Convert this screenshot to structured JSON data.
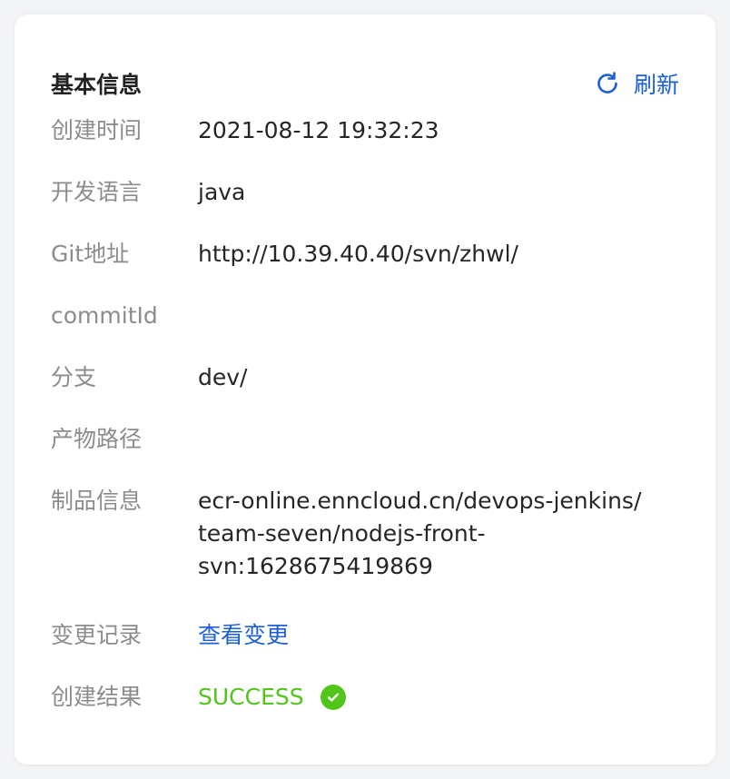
{
  "header": {
    "title": "基本信息",
    "refresh_label": "刷新"
  },
  "fields": [
    {
      "label": "创建时间",
      "value": "2021-08-12  19:32:23"
    },
    {
      "label": "开发语言",
      "value": "java"
    },
    {
      "label": "Git地址",
      "value": "http://10.39.40.40/svn/zhwl/"
    },
    {
      "label": "commitId",
      "value": ""
    },
    {
      "label": "分支",
      "value": "dev/"
    },
    {
      "label": "产物路径",
      "value": ""
    },
    {
      "label": "制品信息",
      "value_lines": [
        "ecr-online.enncloud.cn/devops-jenkins/",
        "team-seven/nodejs-front-",
        "svn:1628675419869"
      ]
    },
    {
      "label": "变更记录",
      "value": "查看变更"
    },
    {
      "label": "创建结果",
      "value": "SUCCESS"
    }
  ],
  "colors": {
    "link": "#1a5fd6",
    "success": "#52c41a"
  },
  "icons": {
    "refresh": "refresh-icon",
    "status": "check-circle-icon"
  }
}
